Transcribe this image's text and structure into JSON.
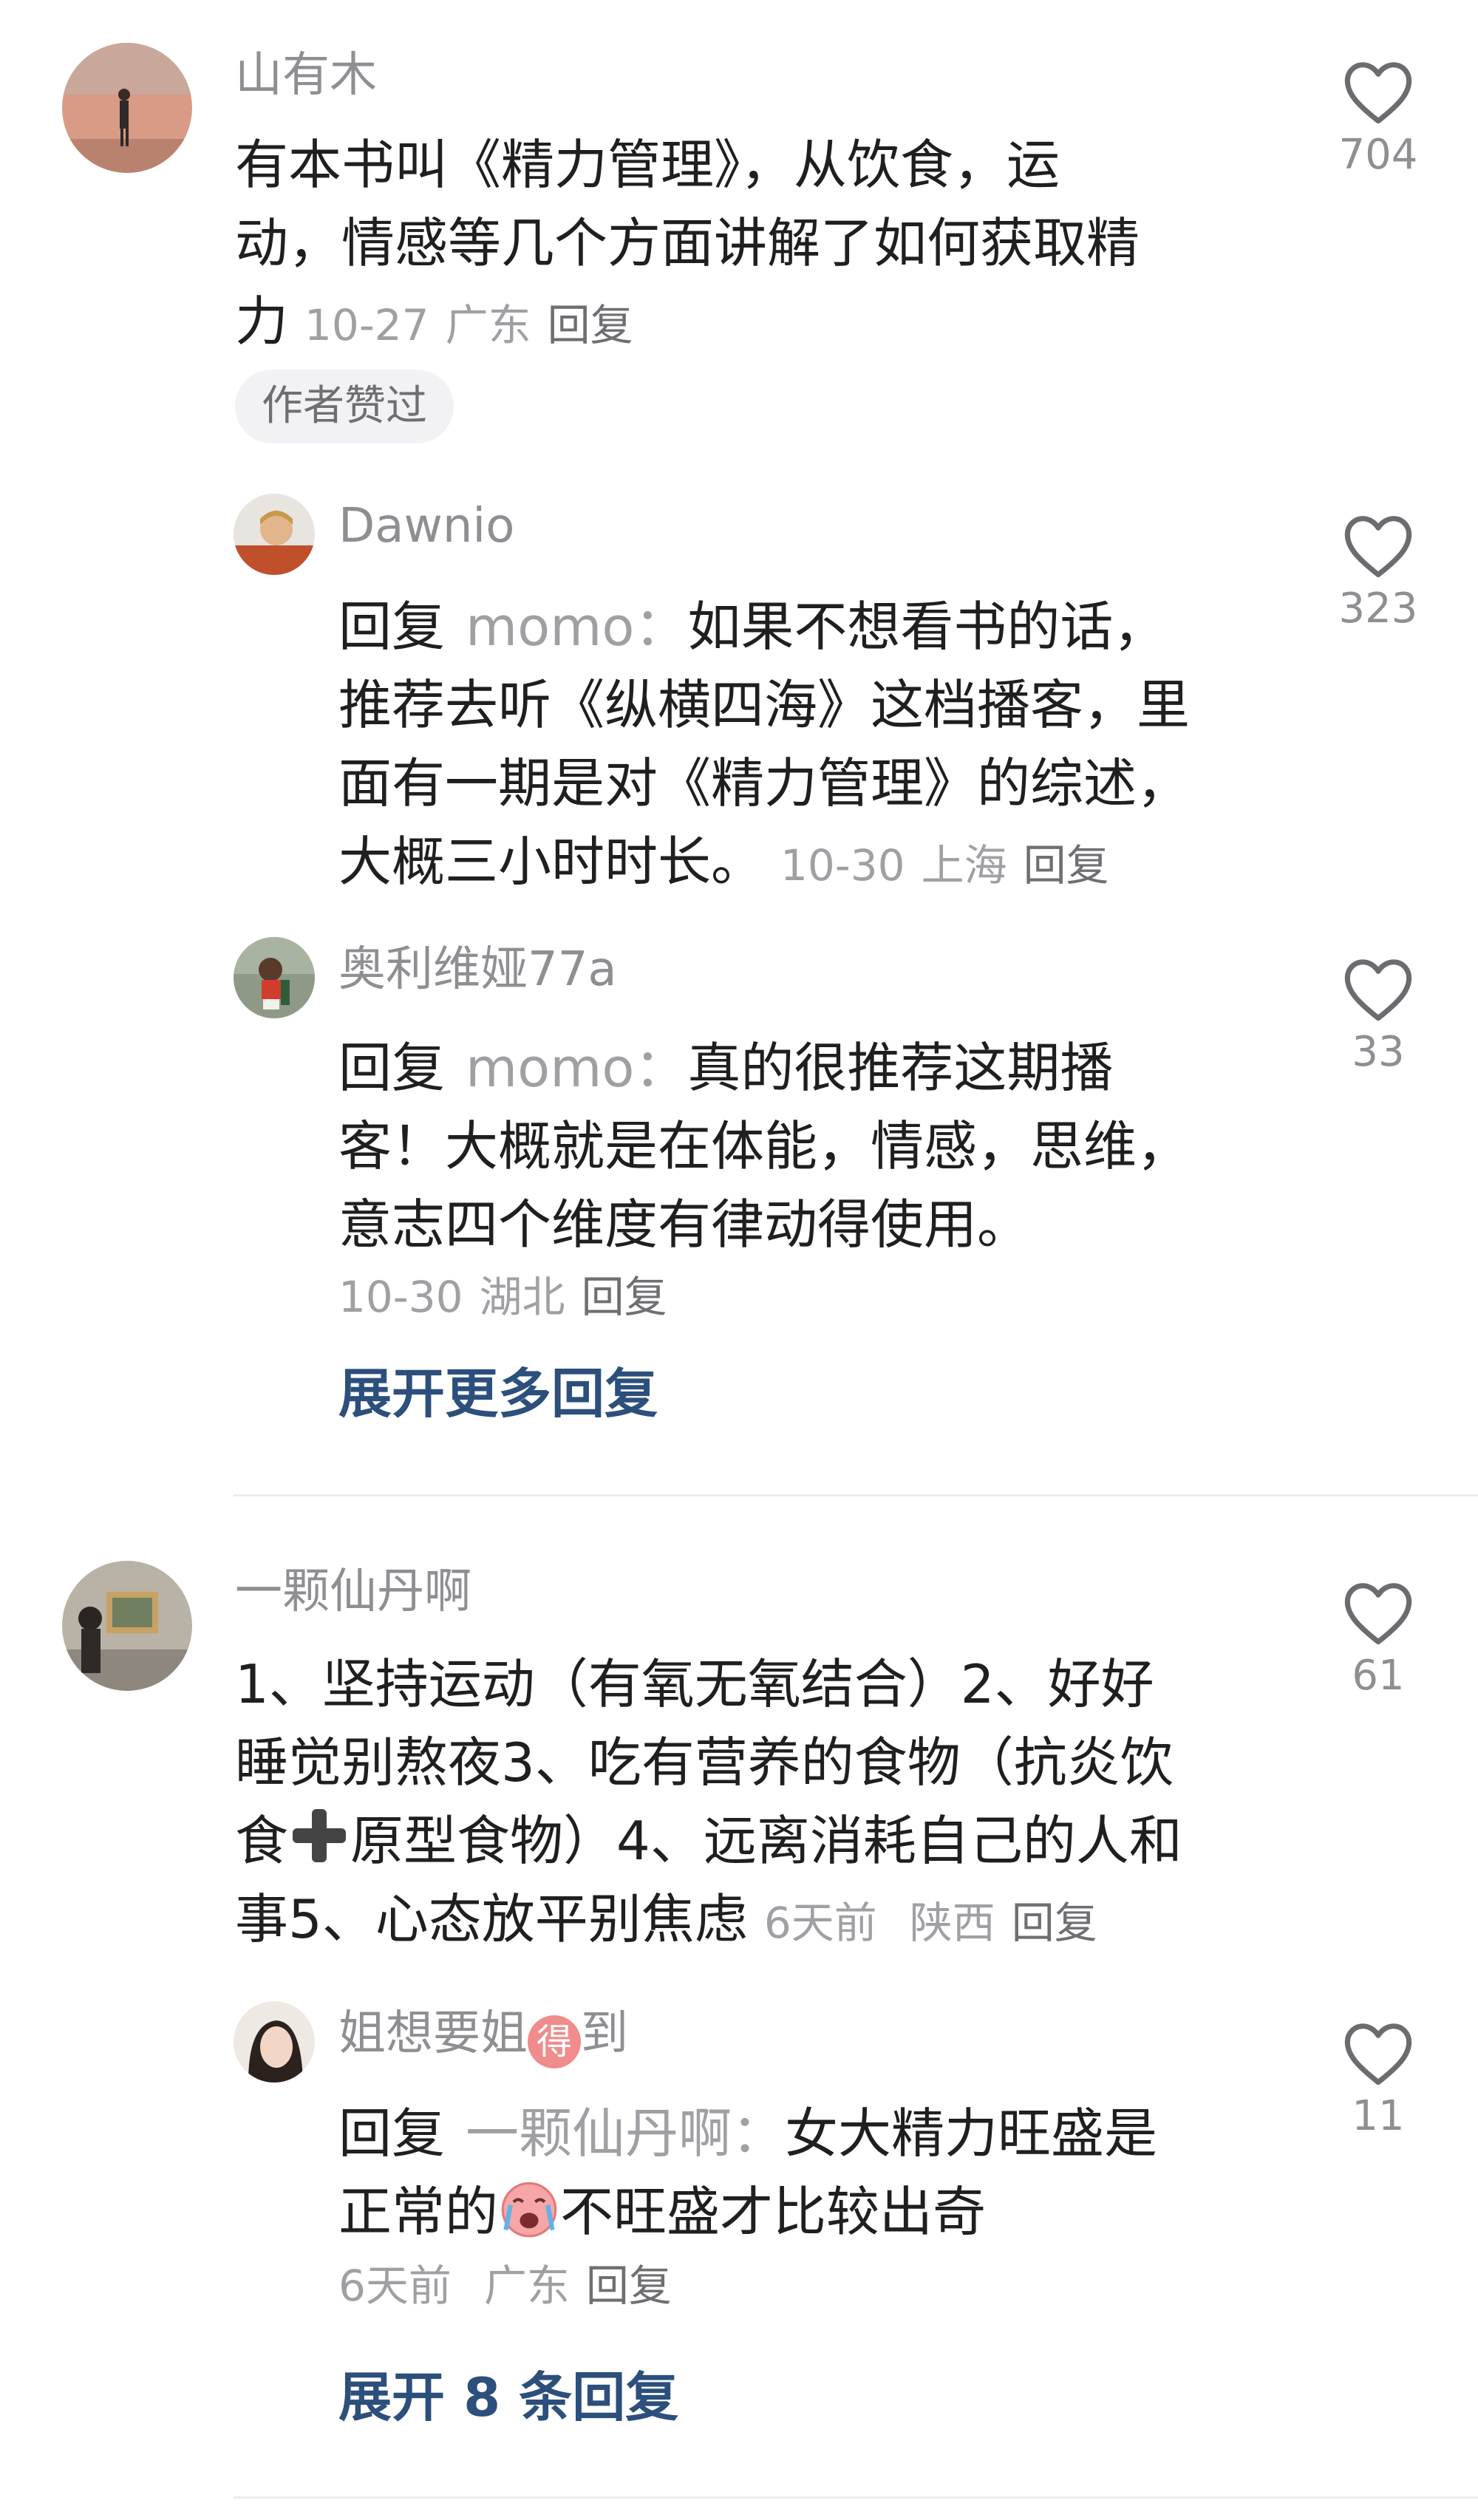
{
  "comments": [
    {
      "username": "山有木",
      "text": "有本书叫《精力管理》，从饮食，运动，情感等几个方面讲解了如何获取精力",
      "line1": "有本书叫《精力管理》，从饮食，运",
      "line2": "动，情感等几个方面讲解了如何获取精",
      "line3": "力",
      "date": "10-27",
      "location": "广东",
      "reply_label": "回复",
      "likes": "704",
      "badge": "作者赞过",
      "replies": [
        {
          "username": "Dawnio",
          "reply_prefix": "回复",
          "reply_to": "momo：",
          "line1_rest": "如果不想看书的话，",
          "line2": "推荐去听《纵横四海》这档播客，里",
          "line3": "面有一期是对《精力管理》的综述，",
          "line4": "大概三小时时长。",
          "date": "10-30",
          "location": "上海",
          "reply_label": "回复",
          "likes": "323"
        },
        {
          "username": "奥利维娅77a",
          "reply_prefix": "回复",
          "reply_to": "momo：",
          "line1_rest": "真的很推荐这期播",
          "line2": "客！大概就是在体能，情感，思维，",
          "line3": "意志四个维度有律动得使用。",
          "date": "10-30",
          "location": "湖北",
          "reply_label": "回复",
          "likes": "33"
        }
      ],
      "expand_label": "展开更多回复"
    },
    {
      "username": "一颗仙丹啊",
      "line1": "1、坚持运动（有氧无氧结合）2、好好",
      "line2": "睡觉别熬夜3、吃有营养的食物（抗炎饮",
      "line3a": "食",
      "line3b": "原型食物）4、远离消耗自己的人和",
      "line4": "事5、心态放平别焦虑",
      "date": "6天前",
      "location": "陕西",
      "reply_label": "回复",
      "likes": "61",
      "replies": [
        {
          "username_a": "姐想要姐",
          "username_badge": "得",
          "username_b": "到",
          "reply_prefix": "回复",
          "reply_to": "一颗仙丹啊：",
          "line1_rest": "女大精力旺盛是",
          "line2a": "正常的",
          "line2b": "不旺盛才比较出奇",
          "date": "6天前",
          "location": "广东",
          "reply_label": "回复",
          "likes": "11"
        }
      ],
      "expand_label": "展开 8 条回复"
    }
  ],
  "icons": {
    "like": "heart-outline-icon",
    "plus": "heavy-plus-emoji",
    "face": "crying-face-emoji"
  },
  "colors": {
    "link_blue": "#2c4f7c",
    "meta_gray": "#a0a0a4",
    "badge_bg": "#f2f2f4"
  }
}
